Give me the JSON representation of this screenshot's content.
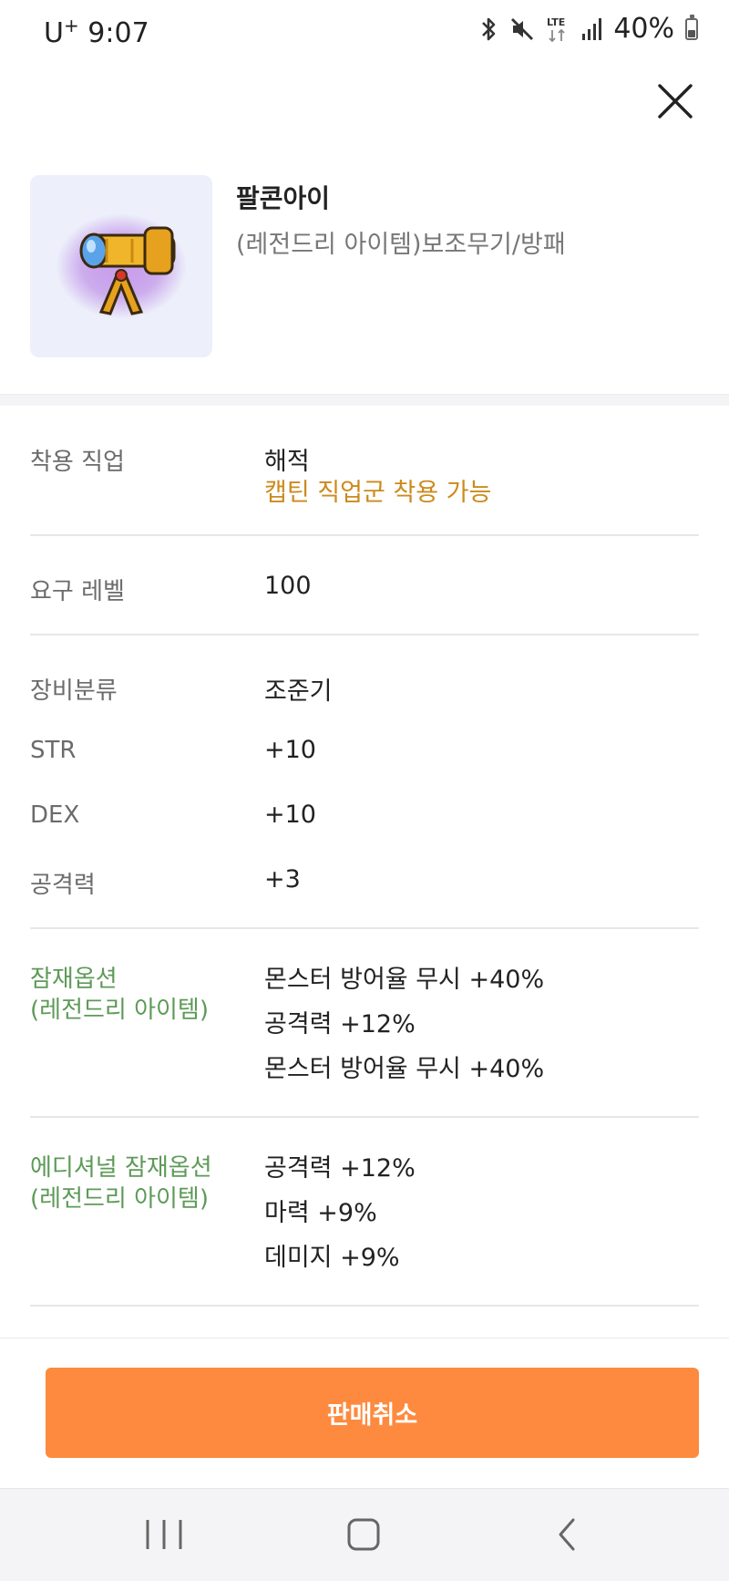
{
  "status_bar": {
    "carrier": "U",
    "carrier_sup": "+",
    "time": "9:07",
    "network": "LTE",
    "battery": "40%",
    "icons": [
      "bluetooth-icon",
      "mute-icon",
      "lte-icon",
      "signal-icon",
      "battery-icon"
    ]
  },
  "item": {
    "name": "팔콘아이",
    "type": "(레전드리 아이템)보조무기/방패",
    "thumbnail_icon": "telescope-item-icon",
    "accent_colors": {
      "thumbnail_bg": "#edf0fb",
      "glow": "#a55bdc",
      "gold": "#e6a11e"
    }
  },
  "details": {
    "job": {
      "label": "착용 직업",
      "value": "해적",
      "note": "캡틴 직업군 착용 가능",
      "note_color": "#cc8a1e"
    },
    "level": {
      "label": "요구 레벨",
      "value": "100"
    },
    "stats": [
      {
        "label": "장비분류",
        "value": "조준기"
      },
      {
        "label": "STR",
        "value": "+10"
      },
      {
        "label": "DEX",
        "value": "+10"
      },
      {
        "label": "공격력",
        "value": "+3"
      }
    ],
    "potential": {
      "label_line1": "잠재옵션",
      "label_line2": "(레전드리 아이템)",
      "label_color": "#5d9a57",
      "values": [
        "몬스터 방어율 무시 +40%",
        "공격력 +12%",
        "몬스터 방어율 무시 +40%"
      ]
    },
    "additional_potential": {
      "label_line1": "에디셔널 잠재옵션",
      "label_line2": "(레전드리 아이템)",
      "values": [
        "공격력 +12%",
        "마력 +9%",
        "데미지 +9%"
      ]
    }
  },
  "actions": {
    "cancel_sale_label": "판매취소",
    "button_color": "#fd8a3e"
  },
  "nav": {
    "icons": [
      "recent-apps-icon",
      "home-icon",
      "back-icon"
    ]
  }
}
